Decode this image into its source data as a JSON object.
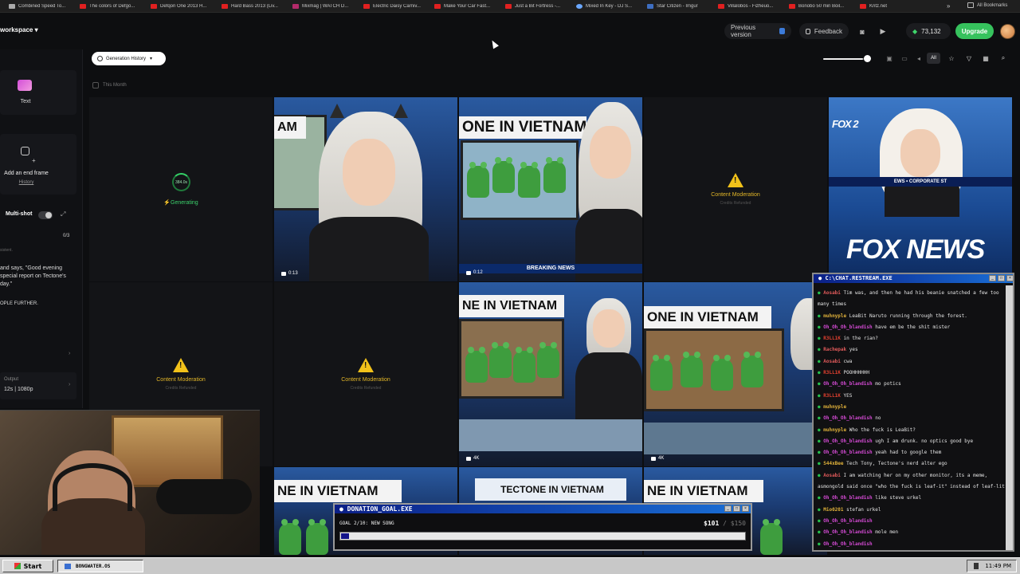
{
  "bookmarks": [
    {
      "label": "Combined Speed To...",
      "icon": "bolt-icon"
    },
    {
      "label": "The colors of Defgo...",
      "icon": "youtube-icon"
    },
    {
      "label": "Defqon One 2013 H...",
      "icon": "youtube-icon"
    },
    {
      "label": "Hard Bass 2013 (Liv...",
      "icon": "youtube-icon"
    },
    {
      "label": "Mixmag | WATCH D...",
      "icon": "mixmag-icon"
    },
    {
      "label": "Electric Daisy Carniv...",
      "icon": "youtube-icon"
    },
    {
      "label": "Make Your Car Fast...",
      "icon": "youtube-icon"
    },
    {
      "label": "Just a Bit Fortress -...",
      "icon": "youtube-icon"
    },
    {
      "label": "Mixed In Key - DJ S...",
      "icon": "globe-icon"
    },
    {
      "label": "Star Citizen - Imgur",
      "icon": "imgur-icon"
    },
    {
      "label": "Villalobos - Fizheuo...",
      "icon": "youtube-icon"
    },
    {
      "label": "Bonobo 50 min Boil...",
      "icon": "youtube-icon"
    },
    {
      "label": "Kritz.net",
      "icon": "youtube-icon"
    }
  ],
  "bookmarks_more": "»",
  "bookmarks_all": "All Bookmarks",
  "topbar": {
    "workspace": "workspace",
    "previous_version": "Previous version",
    "feedback": "Feedback",
    "credits": "73,132",
    "upgrade": "Upgrade"
  },
  "sidebar": {
    "text_label": "Text",
    "end_frame_label": "Add an end frame",
    "history_link": "History",
    "multishot_label": "Multi-shot",
    "shot_count": "0/3",
    "prompt_placeholder": "sistent.",
    "prompt_text": "and says, \"Good evening special report on Tectone's day.\"",
    "prompt_text_2": "OPLE FURTHER.",
    "output_key": "Output",
    "output_value": "12s | 1080p"
  },
  "toolbar": {
    "history_button": "Generation History",
    "filter_all": "All",
    "this_month": "This Month",
    "zoom_level_fraction": 0.9
  },
  "tiles": {
    "generating_timer": "384.0s",
    "generating_label": "Generating",
    "moderation_title": "Content Moderation",
    "moderation_sub": "Credits Refunded",
    "headline_vietnam": "NE IN VIETNAM",
    "headline_vietnam2": "ONE IN VIETNAM",
    "headline_vietnam3": "ONE IN VIETNAM",
    "headline_tectone": "TECTONE IN VIETNAM",
    "headline_am": "AM",
    "breaking": "BREAKING NEWS",
    "fox_news": "FOX NEWS",
    "fox_ticker": "EWS • CORPORATE ST",
    "fox_ticker2": "FOX NE",
    "duration_1": "0:13",
    "duration_2": "0:12",
    "quality_1": "4K",
    "quality_2": "4K",
    "fox_side": "FOX 2"
  },
  "chat": {
    "title": "C:\\CHAT.RESTREAM.EXE",
    "messages": [
      {
        "user": "Aosabi",
        "color": "#e05a5a",
        "text": "Tim was, and then he had his beanie snatched a few too"
      },
      {
        "user": "",
        "color": "#e05a5a",
        "text": "many times"
      },
      {
        "user": "muhnyple",
        "color": "#e0b13a",
        "text": "LeaBit Naruto running through the forest."
      },
      {
        "user": "Oh_Oh_Oh_blandish",
        "color": "#d44ad4",
        "text": "have em be the shit mister"
      },
      {
        "user": "R3LL1K",
        "color": "#e0402f",
        "text": "in the rian?"
      },
      {
        "user": "Rachepak",
        "color": "#e05a5a",
        "text": "yes"
      },
      {
        "user": "Aosabi",
        "color": "#e05a5a",
        "text": "cwa"
      },
      {
        "user": "R3LL1K",
        "color": "#e0402f",
        "text": "POOHHHHHH"
      },
      {
        "user": "Oh_Oh_Oh_blandish",
        "color": "#d44ad4",
        "text": "mo potics"
      },
      {
        "user": "R3LL1K",
        "color": "#e0402f",
        "text": "YES"
      },
      {
        "user": "muhnyple",
        "color": "#e0b13a",
        "text": ""
      },
      {
        "user": "Oh_Oh_Oh_blandish",
        "color": "#d44ad4",
        "text": "no"
      },
      {
        "user": "muhnyple",
        "color": "#e0b13a",
        "text": "Who the fuck is LeaBit?"
      },
      {
        "user": "Oh_Oh_Oh_blandish",
        "color": "#d44ad4",
        "text": "ugh I am drunk. no optics good bye"
      },
      {
        "user": "Oh_Oh_Oh_blandish",
        "color": "#d44ad4",
        "text": "yeah had to google them"
      },
      {
        "user": "S44xBee",
        "color": "#e0b13a",
        "text": "Tech Tony, Tectone's nerd alter ego"
      },
      {
        "user": "Aosabi",
        "color": "#e05a5a",
        "text": "I am watching her on my other monitor, its a meme,"
      },
      {
        "user": "",
        "color": "#e05a5a",
        "text": "asmongold said once \"who the fuck is leaf-it\" instead of leaf-lit"
      },
      {
        "user": "Oh_Oh_Oh_blandish",
        "color": "#d44ad4",
        "text": "like steve urkel"
      },
      {
        "user": "Mio0201",
        "color": "#e0b13a",
        "text": "stefan urkel"
      },
      {
        "user": "Oh_Oh_Oh_blandish",
        "color": "#d44ad4",
        "text": ""
      },
      {
        "user": "Oh_Oh_Oh_blandish",
        "color": "#d44ad4",
        "text": "mole men"
      },
      {
        "user": "Oh_Oh_Oh_blandish",
        "color": "#d44ad4",
        "text": ""
      }
    ]
  },
  "donation": {
    "title": "DONATION_GOAL.EXE",
    "goal": "GOAL 2/10: NEW SONG",
    "amount": "$101",
    "target": "/ $150",
    "progress_fraction": 0.02
  },
  "taskbar": {
    "start": "Start",
    "task": "BONGWATER.OS",
    "clock": "11:49 PM"
  }
}
